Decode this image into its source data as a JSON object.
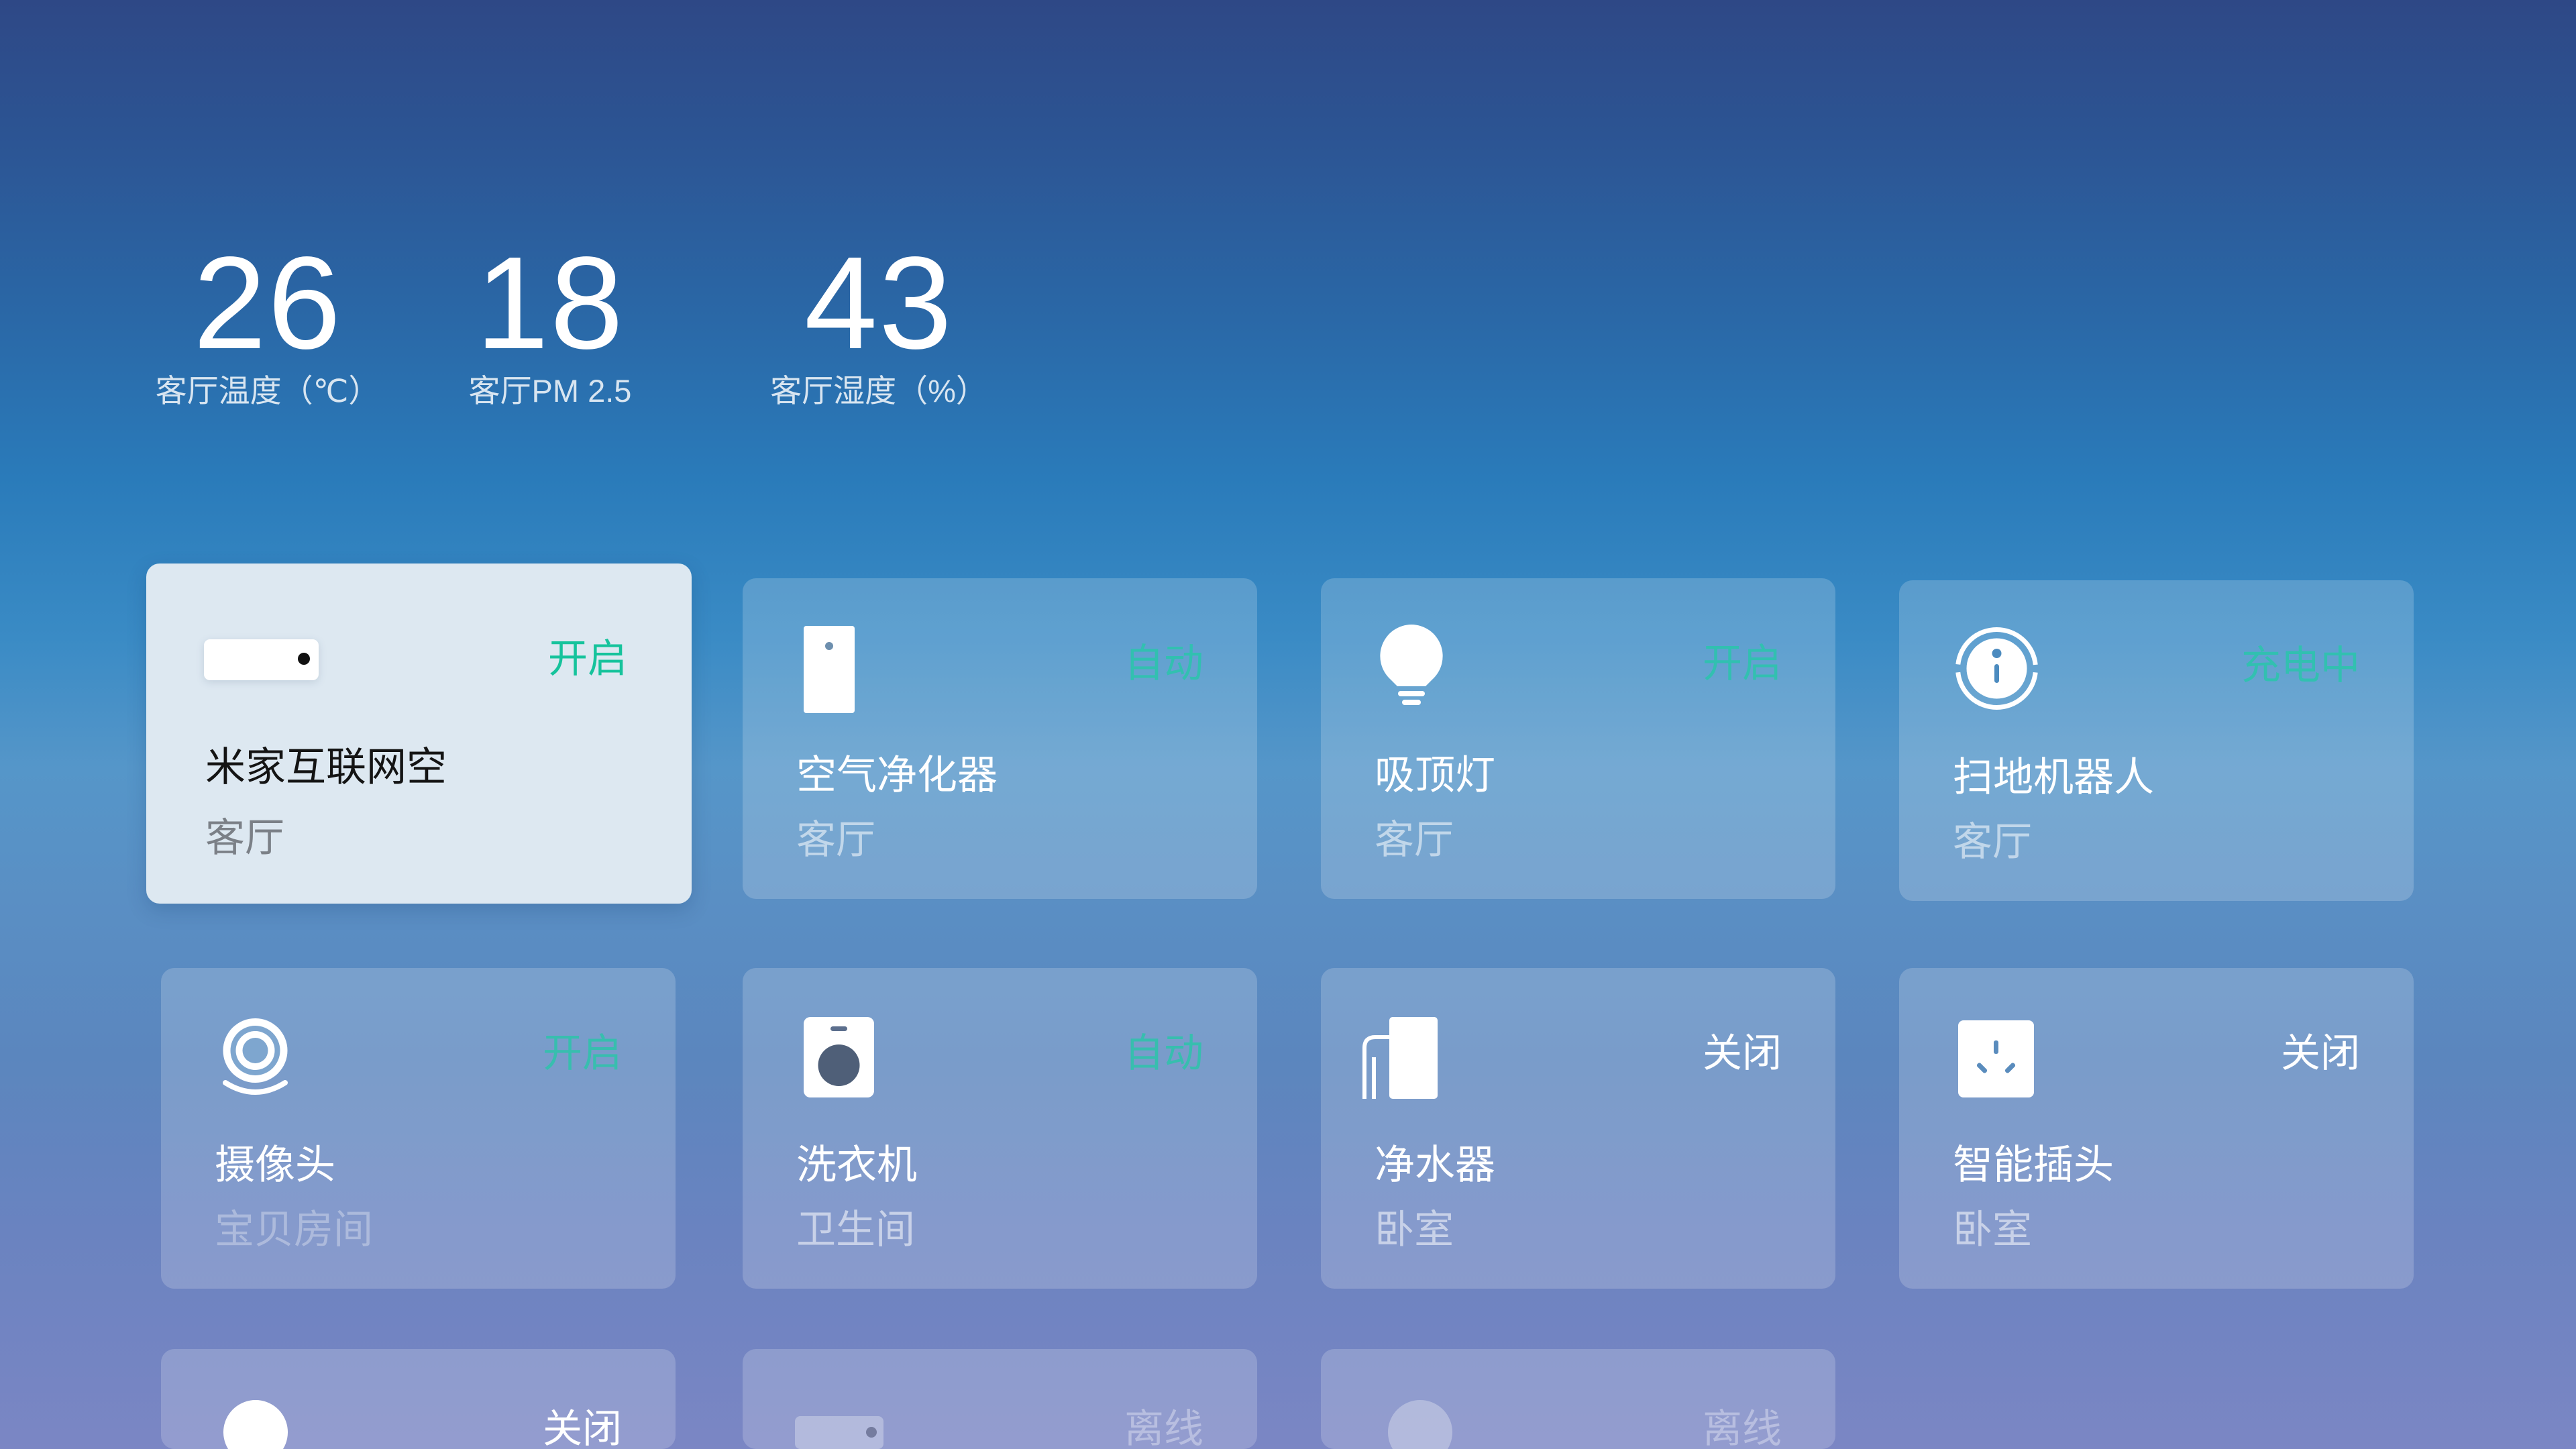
{
  "stats": [
    {
      "value": "26",
      "label": "客厅温度（℃）"
    },
    {
      "value": "18",
      "label": "客厅PM 2.5"
    },
    {
      "value": "43",
      "label": "客厅湿度（%）"
    }
  ],
  "devices": [
    {
      "name": "米家互联网空",
      "room": "客厅",
      "status": "开启",
      "icon": "air-conditioner-icon",
      "focused": true
    },
    {
      "name": "空气净化器",
      "room": "客厅",
      "status": "自动",
      "icon": "air-purifier-icon"
    },
    {
      "name": "吸顶灯",
      "room": "客厅",
      "status": "开启",
      "icon": "ceiling-light-icon"
    },
    {
      "name": "扫地机器人",
      "room": "客厅",
      "status": "充电中",
      "icon": "robot-vacuum-icon"
    },
    {
      "name": "摄像头",
      "room": "宝贝房间",
      "status": "开启",
      "icon": "camera-icon"
    },
    {
      "name": "洗衣机",
      "room": "卫生间",
      "status": "自动",
      "icon": "washing-machine-icon"
    },
    {
      "name": "净水器",
      "room": "卧室",
      "status": "关闭",
      "icon": "water-purifier-icon"
    },
    {
      "name": "智能插头",
      "room": "卧室",
      "status": "关闭",
      "icon": "smart-plug-icon"
    },
    {
      "status": "关闭",
      "icon": "round-device-icon"
    },
    {
      "status": "离线",
      "icon": "air-conditioner-icon"
    },
    {
      "status": "离线",
      "icon": "round-device-icon"
    }
  ],
  "colors": {
    "accent": "#1fcca4",
    "accent_strong": "#16c39c",
    "focused_card": "#dde8f1",
    "background_top": "#2e4886",
    "background_bottom": "#7b86c4"
  }
}
